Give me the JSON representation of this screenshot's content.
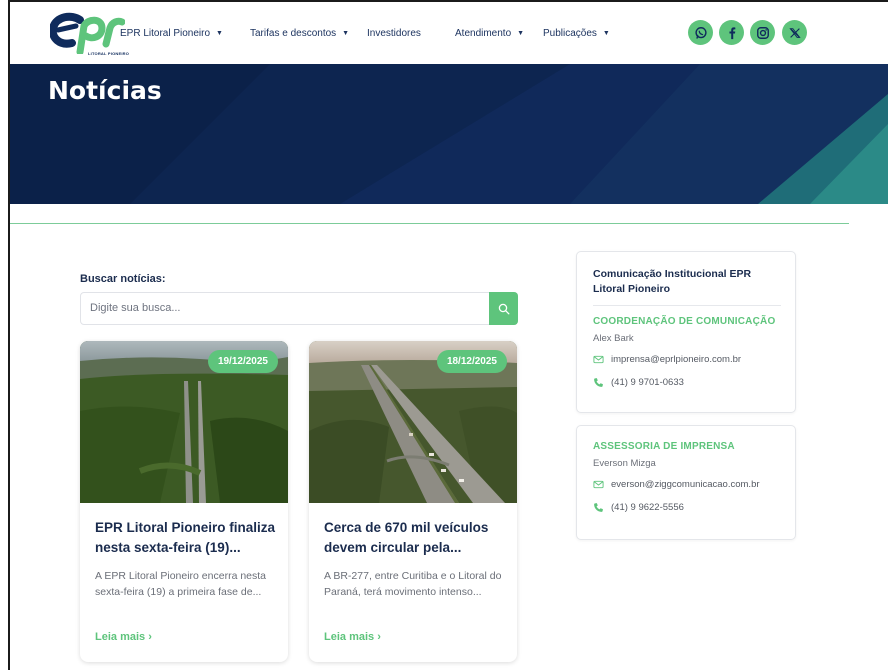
{
  "header": {
    "logo_text": "epr",
    "logo_subtext": "LITORAL PIONEIRO",
    "nav": [
      {
        "label": "EPR Litoral Pioneiro",
        "dropdown": true
      },
      {
        "label": "Tarifas e descontos",
        "dropdown": true
      },
      {
        "label": "Investidores",
        "dropdown": false
      },
      {
        "label": "Atendimento",
        "dropdown": true
      },
      {
        "label": "Publicações",
        "dropdown": true
      }
    ],
    "social_icons": [
      "whatsapp-icon",
      "facebook-icon",
      "instagram-icon",
      "x-icon"
    ]
  },
  "hero": {
    "title": "Notícias"
  },
  "search": {
    "label": "Buscar notícias:",
    "placeholder": "Digite sua busca...",
    "button_icon": "search-icon"
  },
  "cards": [
    {
      "date": "19/12/2025",
      "title": "EPR Litoral Pioneiro finaliza nesta sexta-feira (19)...",
      "excerpt": "A EPR Litoral Pioneiro encerra nesta sexta-feira (19) a primeira fase de...",
      "link": "Leia mais  ›"
    },
    {
      "date": "18/12/2025",
      "title": "Cerca de 670 mil veículos devem circular pela...",
      "excerpt": "A BR-277, entre Curitiba e o Litoral do Paraná, terá movimento intenso...",
      "link": "Leia mais  ›"
    }
  ],
  "contacts": {
    "title": "Comunicação Institucional EPR Litoral Pioneiro",
    "blocks": [
      {
        "role": "COORDENAÇÃO DE COMUNICAÇÃO",
        "name": "Alex Bark",
        "email": "imprensa@eprlpioneiro.com.br",
        "phone": "(41) 9 9701-0633"
      },
      {
        "role": "ASSESSORIA DE IMPRENSA",
        "name": "Everson Mizga",
        "email": "everson@ziggcomunicacao.com.br",
        "phone": "(41) 9 9622-5556"
      }
    ]
  },
  "colors": {
    "accent_green": "#5ec47c",
    "navy": "#0d2550",
    "text_dark": "#1b2c4e"
  }
}
